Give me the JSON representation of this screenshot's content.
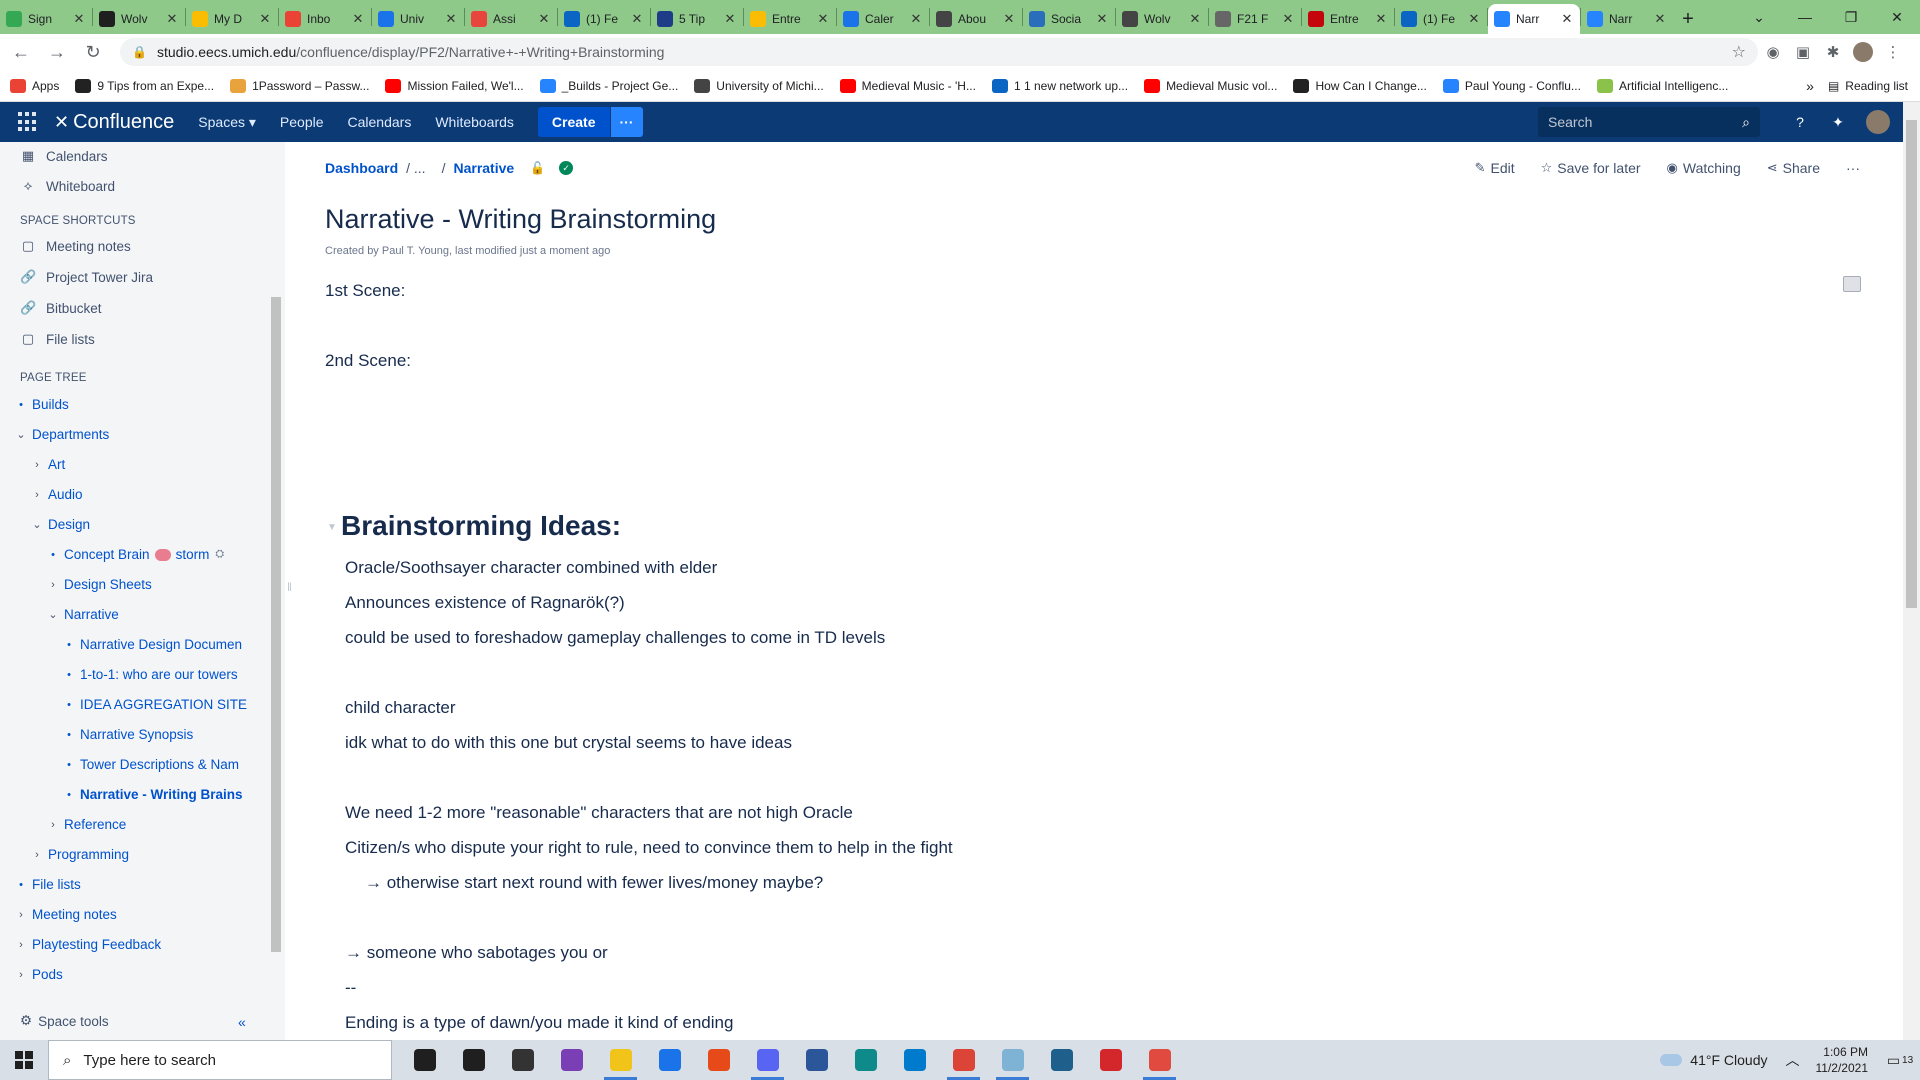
{
  "browser": {
    "tabs": [
      {
        "title": "Sign",
        "color": "#34a853"
      },
      {
        "title": "Wolv",
        "color": "#1f1f1f"
      },
      {
        "title": "My D",
        "color": "#fbbc04"
      },
      {
        "title": "Inbo",
        "color": "#ea4335"
      },
      {
        "title": "Univ",
        "color": "#1a73e8"
      },
      {
        "title": "Assi",
        "color": "#e8453c"
      },
      {
        "title": "(1) Fe",
        "color": "#0a66c2"
      },
      {
        "title": "5 Tip",
        "color": "#1f3c88"
      },
      {
        "title": "Entre",
        "color": "#fbbc04"
      },
      {
        "title": "Caler",
        "color": "#1a73e8"
      },
      {
        "title": "Abou",
        "color": "#444444"
      },
      {
        "title": "Socia",
        "color": "#2a6ebb"
      },
      {
        "title": "Wolv",
        "color": "#444444"
      },
      {
        "title": "F21 F",
        "color": "#666666"
      },
      {
        "title": "Entre",
        "color": "#c5050c"
      },
      {
        "title": "(1) Fe",
        "color": "#0a66c2"
      },
      {
        "title": "Narr",
        "color": "#2684ff"
      },
      {
        "title": "Narr",
        "color": "#2684ff"
      }
    ],
    "active_tab_index": 16,
    "url_host": "studio.eecs.umich.edu",
    "url_path": "/confluence/display/PF2/Narrative+-+Writing+Brainstorming",
    "bookmarks": [
      {
        "label": "Apps",
        "color": "#ea4335"
      },
      {
        "label": "9 Tips from an Expe...",
        "color": "#222222"
      },
      {
        "label": "1Password – Passw...",
        "color": "#e8a33c"
      },
      {
        "label": "Mission Failed, We'l...",
        "color": "#ff0000"
      },
      {
        "label": "_Builds - Project Ge...",
        "color": "#2684ff"
      },
      {
        "label": "University of Michi...",
        "color": "#444444"
      },
      {
        "label": "Medieval Music - 'H...",
        "color": "#ff0000"
      },
      {
        "label": "1 1 new network up...",
        "color": "#0a66c2"
      },
      {
        "label": "Medieval Music vol...",
        "color": "#ff0000"
      },
      {
        "label": "How Can I Change...",
        "color": "#222222"
      },
      {
        "label": "Paul Young - Conflu...",
        "color": "#2684ff"
      },
      {
        "label": "Artificial Intelligenc...",
        "color": "#8bc34a"
      }
    ],
    "bookmarks_more": "»",
    "reading_list": "Reading list"
  },
  "confluence": {
    "logo": "Confluence",
    "nav": {
      "spaces": "Spaces ▾",
      "people": "People",
      "calendars": "Calendars",
      "whiteboards": "Whiteboards"
    },
    "create": "Create",
    "more": "···",
    "search_placeholder": "Search"
  },
  "sidebar": {
    "calendars": "Calendars",
    "whiteboard": "Whiteboard",
    "shortcuts_heading": "SPACE SHORTCUTS",
    "shortcuts": [
      "Meeting notes",
      "Project Tower Jira",
      "Bitbucket",
      "File lists"
    ],
    "page_tree_heading": "PAGE TREE",
    "tree": {
      "builds": "Builds",
      "departments": "Departments",
      "art": "Art",
      "audio": "Audio",
      "design": "Design",
      "concept_a": "Concept Brain",
      "concept_b": "storm",
      "design_sheets": "Design Sheets",
      "narrative": "Narrative",
      "narrative_children": [
        "Narrative Design Documen",
        "1-to-1: who are our towers",
        "IDEA AGGREGATION SITE",
        "Narrative Synopsis",
        "Tower Descriptions & Nam",
        "Narrative - Writing Brains"
      ],
      "reference": "Reference",
      "programming": "Programming",
      "file_lists": "File lists",
      "meeting_notes": "Meeting notes",
      "playtesting": "Playtesting Feedback",
      "pods": "Pods"
    },
    "space_tools": "Space tools",
    "collapse": "«"
  },
  "page": {
    "breadcrumb": {
      "dashboard": "Dashboard",
      "ellipsis": "/ ...",
      "sep": "/",
      "narrative": "Narrative"
    },
    "actions": {
      "edit": "Edit",
      "save": "Save for later",
      "watching": "Watching",
      "share": "Share",
      "more": "···"
    },
    "title": "Narrative - Writing Brainstorming",
    "byline": "Created by Paul T. Young, last modified just a moment ago",
    "scene1": "1st Scene:",
    "scene2": "2nd Scene:",
    "heading": "Brainstorming Ideas:",
    "lines": [
      "Oracle/Soothsayer character combined with elder",
      "Announces existence of Ragnarök(?)",
      "could be used to foreshadow gameplay challenges to come in TD levels",
      "child character",
      "idk what to do with this one but crystal seems to have ideas",
      "We need 1-2 more \"reasonable\" characters that are not high Oracle",
      "Citizen/s who dispute your right to rule, need to convince them to help in the fight",
      "→ otherwise start next round with fewer lives/money maybe?",
      "→ someone who sabotages you or",
      "--",
      "Ending is a type of dawn/you made it kind of ending"
    ]
  },
  "taskbar": {
    "search_placeholder": "Type here to search",
    "apps": [
      {
        "name": "cortana-icon",
        "color": "#1f1f1f",
        "run": false
      },
      {
        "name": "task-view-icon",
        "color": "#1f1f1f",
        "run": false
      },
      {
        "name": "store-icon",
        "color": "#333333",
        "run": false
      },
      {
        "name": "app-purple-icon",
        "color": "#7b3fb5",
        "run": false
      },
      {
        "name": "file-explorer-icon",
        "color": "#f0c419",
        "run": true
      },
      {
        "name": "mail-icon",
        "color": "#1a73e8",
        "run": false
      },
      {
        "name": "office-icon",
        "color": "#e64a19",
        "run": false
      },
      {
        "name": "discord-icon",
        "color": "#5865f2",
        "run": true
      },
      {
        "name": "word-icon",
        "color": "#2b579a",
        "run": false
      },
      {
        "name": "edge-icon",
        "color": "#0f8a8a",
        "run": false
      },
      {
        "name": "vscode-icon",
        "color": "#007acc",
        "run": false
      },
      {
        "name": "chrome-app-icon",
        "color": "#db4437",
        "run": true
      },
      {
        "name": "app-light-icon",
        "color": "#7fb3d5",
        "run": true
      },
      {
        "name": "photos-icon",
        "color": "#1f5f8b",
        "run": false
      },
      {
        "name": "acrobat-icon",
        "color": "#d4272c",
        "run": false
      },
      {
        "name": "chrome-icon",
        "color": "#e04a3f",
        "run": true
      }
    ],
    "weather": "41°F  Cloudy",
    "time": "1:06 PM",
    "date": "11/2/2021",
    "notifications": "13"
  }
}
